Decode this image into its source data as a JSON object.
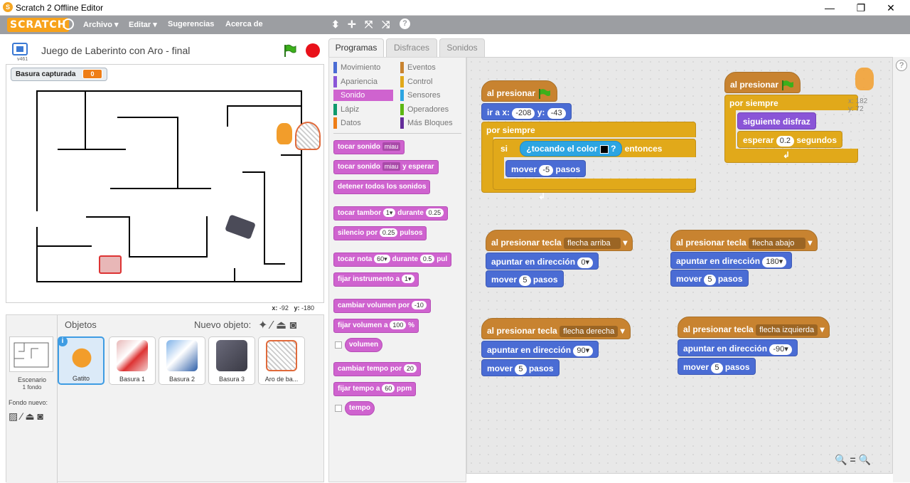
{
  "window": {
    "title": "Scratch 2 Offline Editor",
    "minimize": "—",
    "maximize": "❐",
    "close": "✕"
  },
  "menu": {
    "logo": "SCRATCH",
    "items": [
      "Archivo ▾",
      "Editar ▾",
      "Sugerencias",
      "Acerca de"
    ],
    "tools": [
      "⬍",
      "✛",
      "⤧",
      "⤨",
      "?"
    ]
  },
  "stage": {
    "title": "Juego de Laberinto con Aro - final",
    "version": "v461",
    "monitor_label": "Basura capturada",
    "monitor_value": "0",
    "coords_x_label": "x:",
    "coords_x": "-92",
    "coords_y_label": "y:",
    "coords_y": "-180"
  },
  "sprites": {
    "header": "Objetos",
    "new_object": "Nuevo objeto:",
    "stage_label": "Escenario",
    "stage_sub": "1 fondo",
    "new_bg": "Fondo nuevo:",
    "items": [
      "Gatito",
      "Basura 1",
      "Basura 2",
      "Basura 3",
      "Aro de ba..."
    ]
  },
  "tabs": [
    "Programas",
    "Disfraces",
    "Sonidos"
  ],
  "categories": {
    "left": [
      "Movimiento",
      "Apariencia",
      "Sonido",
      "Lápiz",
      "Datos"
    ],
    "right": [
      "Eventos",
      "Control",
      "Sensores",
      "Operadores",
      "Más Bloques"
    ],
    "colors": {
      "Movimiento": "#4a6cd4",
      "Apariencia": "#8a55d7",
      "Sonido": "#cf63cf",
      "Lápiz": "#0e9a6c",
      "Datos": "#ee7d16",
      "Eventos": "#c88330",
      "Control": "#e1a91a",
      "Sensores": "#2ca5e2",
      "Operadores": "#5cb712",
      "Más Bloques": "#632d99"
    }
  },
  "palette": {
    "b1": "tocar sonido",
    "b1s": "miau",
    "b2": "tocar sonido",
    "b2s": "miau",
    "b2b": "y esperar",
    "b3": "detener todos los sonidos",
    "b4": "tocar tambor",
    "b4n": "1▾",
    "b4b": "durante",
    "b4m": "0.25",
    "b5": "silencio por",
    "b5n": "0.25",
    "b5b": "pulsos",
    "b6": "tocar nota",
    "b6n": "60▾",
    "b6b": "durante",
    "b6m": "0.5",
    "b6c": "pul",
    "b7": "fijar instrumento a",
    "b7n": "1▾",
    "b8": "cambiar volumen por",
    "b8n": "-10",
    "b9": "fijar volumen a",
    "b9n": "100",
    "b9b": "%",
    "b10": "volumen",
    "b11": "cambiar tempo por",
    "b11n": "20",
    "b12": "fijar tempo a",
    "b12n": "60",
    "b12b": "ppm",
    "b13": "tempo"
  },
  "scripts": {
    "s1_hat": "al presionar",
    "s1_goto": "ir a x:",
    "s1_x": "-208",
    "s1_ylab": "y:",
    "s1_y": "-43",
    "s1_forever": "por siempre",
    "s1_if": "si",
    "s1_touch": "¿tocando el color",
    "s1_q": "?",
    "s1_then": "entonces",
    "s1_move": "mover",
    "s1_move_n": "-5",
    "s1_pasos": "pasos",
    "s2_hat": "al presionar",
    "s2_forever": "por siempre",
    "s2_next": "siguiente disfraz",
    "s2_wait": "esperar",
    "s2_wait_n": "0.2",
    "s2_seg": "segundos",
    "k1_hat": "al presionar tecla",
    "k1_key": "flecha arriba",
    "k1_point": "apuntar en dirección",
    "k1_dir": "0▾",
    "k1_move": "mover",
    "k1_n": "5",
    "k1_pasos": "pasos",
    "k2_hat": "al presionar tecla",
    "k2_key": "flecha abajo",
    "k2_point": "apuntar en dirección",
    "k2_dir": "180▾",
    "k2_move": "mover",
    "k2_n": "5",
    "k2_pasos": "pasos",
    "k3_hat": "al presionar tecla",
    "k3_key": "flecha derecha",
    "k3_point": "apuntar en dirección",
    "k3_dir": "90▾",
    "k3_move": "mover",
    "k3_n": "5",
    "k3_pasos": "pasos",
    "k4_hat": "al presionar tecla",
    "k4_key": "flecha izquierda",
    "k4_point": "apuntar en dirección",
    "k4_dir": "-90▾",
    "k4_move": "mover",
    "k4_n": "5",
    "k4_pasos": "pasos",
    "sprite_x": "x: 182",
    "sprite_y": "y: 72",
    "zoom": "🔍 = 🔍"
  }
}
